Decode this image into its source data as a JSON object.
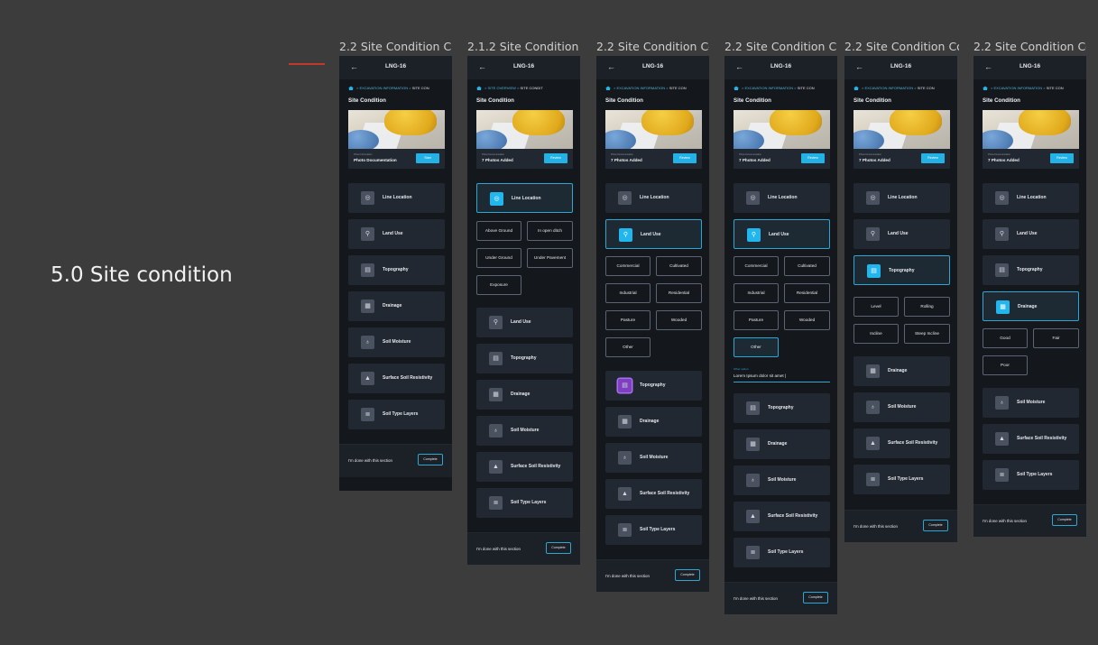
{
  "section_title": "5.0 Site condition",
  "labels": [
    "2.2 Site Condition Co...",
    "2.1.2 Site Condition -...",
    "2.2 Site Condition Co...",
    "2.2 Site Condition Co...",
    "2.2 Site Condition Co...",
    "2.2 Site Condition Co..."
  ],
  "header": {
    "back": "←",
    "title": "LNG-16"
  },
  "crumbs": {
    "excavation": "EXCAVATION INFORMATION",
    "overview": "SITE OVERVIEW",
    "cur1": "SITE CON",
    "cur2": "SITE CONDIT"
  },
  "sc_title": "Site Condition",
  "photo": {
    "caption_start": "Photo Information",
    "caption_added": "Photo Documentation",
    "main_start": "Photo Documentation",
    "main_added": "7 Photos Added",
    "start_btn": "Start",
    "review_btn": "Review"
  },
  "cards": {
    "line": "Line Location",
    "land": "Land Use",
    "topo": "Topography",
    "drain": "Drainage",
    "moist": "Soil Moisture",
    "resist": "Surface Soil Resistivity",
    "layers": "Soil Type Layers"
  },
  "line_opts": [
    "Above Ground",
    "In open ditch",
    "Under Ground",
    "Under Pavement",
    "Exposure"
  ],
  "land_opts": [
    "Commercial",
    "Cultivated",
    "Industrial",
    "Residential",
    "Pasture",
    "Wooded",
    "Other"
  ],
  "topo_opts": [
    "Level",
    "Rolling",
    "Incline",
    "Steep Incline"
  ],
  "drain_opts": [
    "Good",
    "Fair",
    "Poor"
  ],
  "other_field": {
    "label": "Other option",
    "value": "Lorem Ipsum dolor sit amet |"
  },
  "footer": {
    "text": "I'm done with this section",
    "btn": "Complete"
  }
}
